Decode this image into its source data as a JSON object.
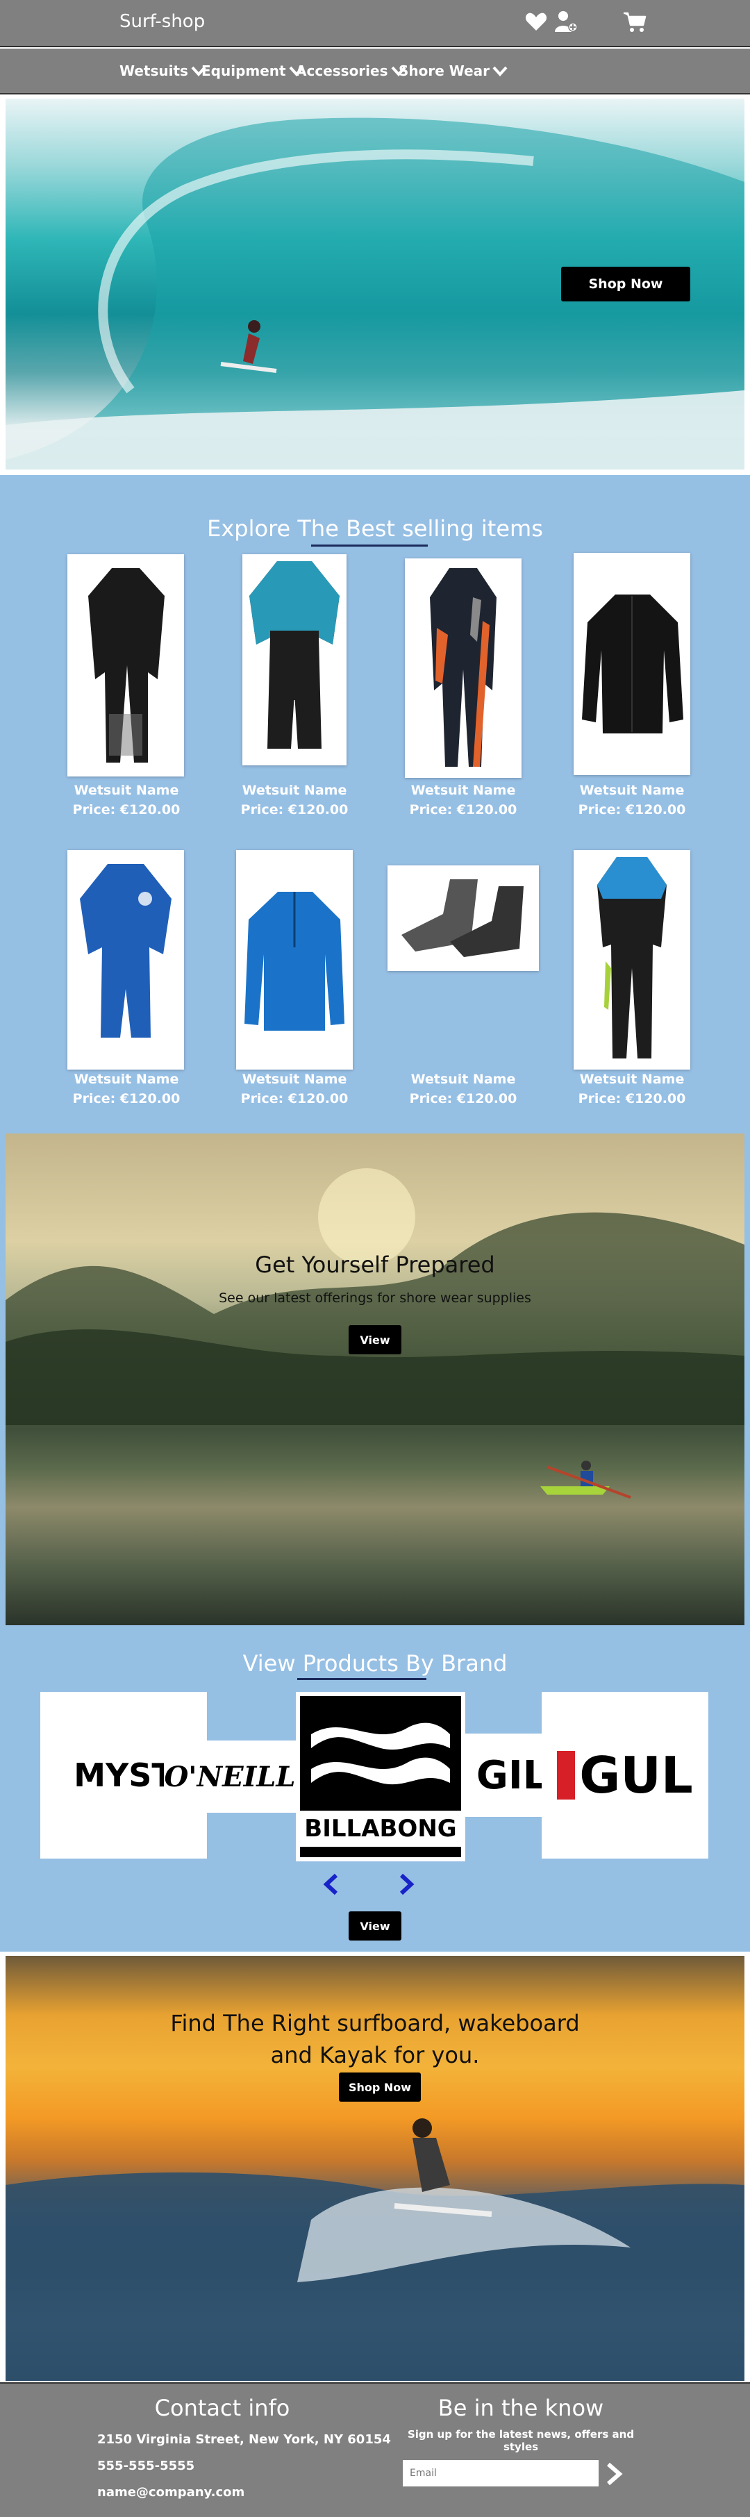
{
  "header": {
    "brand": "Surf-shop"
  },
  "nav": {
    "items": [
      "Wetsuits",
      "Equipment",
      "Accessories",
      "Shore Wear"
    ]
  },
  "hero": {
    "cta": "Shop Now"
  },
  "bestselling": {
    "title": "Explore The Best selling items",
    "products": [
      {
        "name": "Wetsuit Name",
        "price": "Price: €120.00"
      },
      {
        "name": "Wetsuit Name",
        "price": "Price: €120.00"
      },
      {
        "name": "Wetsuit Name",
        "price": "Price: €120.00"
      },
      {
        "name": "Wetsuit Name",
        "price": "Price: €120.00"
      },
      {
        "name": "Wetsuit Name",
        "price": "Price: €120.00"
      },
      {
        "name": "Wetsuit Name",
        "price": "Price: €120.00"
      },
      {
        "name": "Wetsuit Name",
        "price": "Price: €120.00"
      },
      {
        "name": "Wetsuit Name",
        "price": "Price: €120.00"
      }
    ]
  },
  "prepared": {
    "title": "Get Yourself Prepared",
    "subtitle": "See our latest offerings for shore wear supplies",
    "cta": "View"
  },
  "brands": {
    "title": "View Products By Brand",
    "items": [
      "MYST",
      "O'NEILL",
      "BILLABONG",
      "GILL",
      "GUL"
    ],
    "cta": "View"
  },
  "surf": {
    "title_line1": "Find The Right surfboard, wakeboard",
    "title_line2": "and Kayak for you.",
    "cta": "Shop Now"
  },
  "footer": {
    "contact_title": "Contact info",
    "address": "2150 Virginia Street, New York, NY 60154",
    "phone": "555-555-5555",
    "email": "name@company.com",
    "news_title": "Be in the know",
    "news_sub": "Sign up for the latest news, offers and styles",
    "email_placeholder": "Email"
  }
}
